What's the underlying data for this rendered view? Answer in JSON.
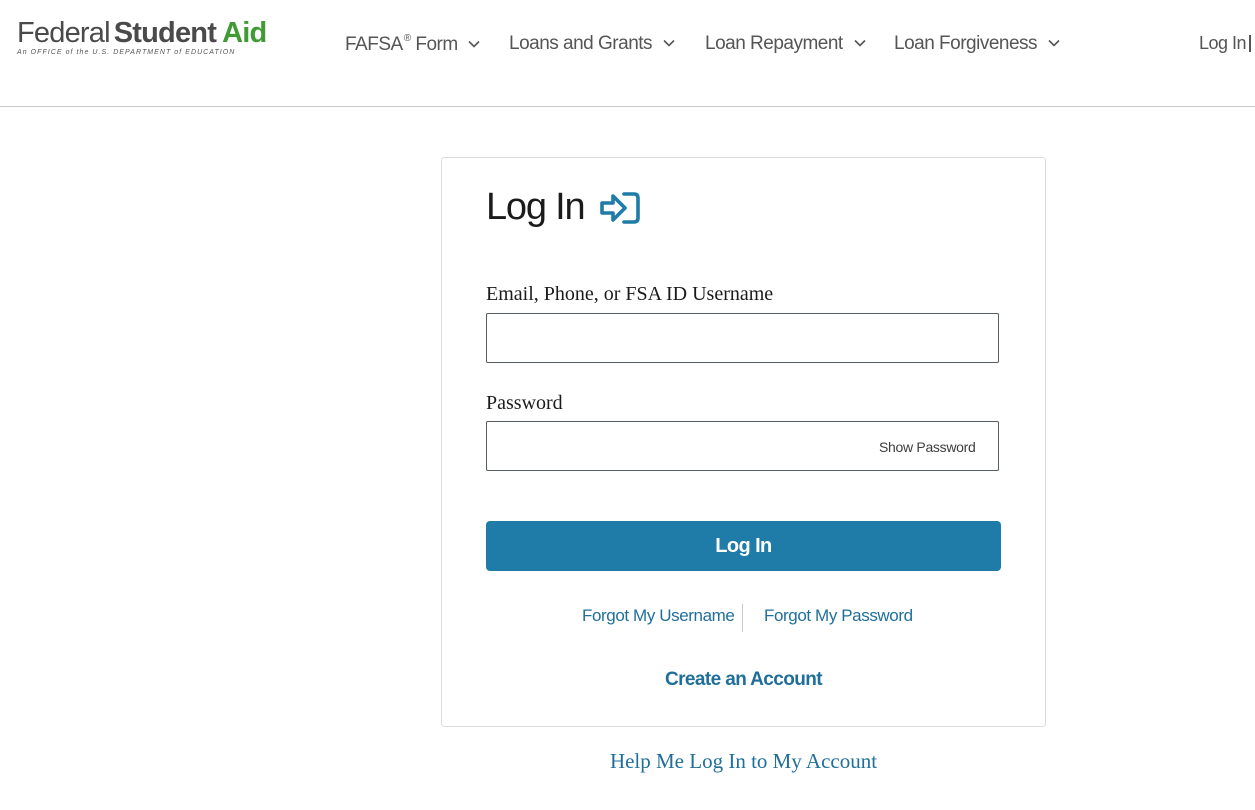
{
  "header": {
    "logo": {
      "word1": "Federal",
      "word2": "Student",
      "word3": "Aid",
      "tagline": "An OFFICE of the U.S. DEPARTMENT of EDUCATION",
      "brand_green": "#3f9c35"
    },
    "nav": [
      {
        "label": "FAFSA",
        "sup": "®",
        "label_suffix": " Form",
        "icon": "chevron-down-icon"
      },
      {
        "label": "Loans and Grants",
        "icon": "chevron-down-icon"
      },
      {
        "label": "Loan Repayment",
        "icon": "chevron-down-icon"
      },
      {
        "label": "Loan Forgiveness",
        "icon": "chevron-down-icon"
      }
    ],
    "login_label": "Log In"
  },
  "login_card": {
    "title": "Log In",
    "title_icon": "sign-in-arrow-icon",
    "username_label": "Email, Phone, or FSA ID Username",
    "username_value": "",
    "password_label": "Password",
    "password_value": "",
    "show_password_label": "Show Password",
    "submit_label": "Log In",
    "forgot_username": "Forgot My Username",
    "forgot_password": "Forgot My Password",
    "create_account": "Create an Account"
  },
  "help_link": "Help Me Log In to My Account",
  "colors": {
    "accent": "#1f7ba8",
    "link": "#1f6f9a",
    "text": "#1b1b1b"
  }
}
